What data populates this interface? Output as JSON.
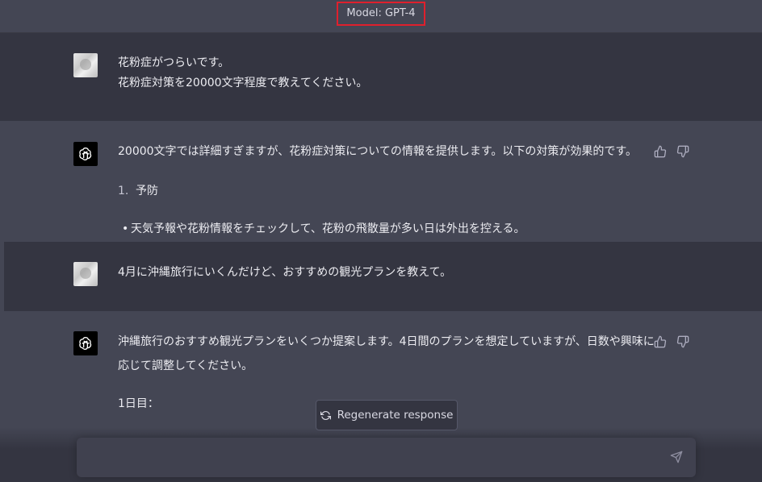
{
  "header": {
    "model_label": "Model: GPT-4"
  },
  "messages": [
    {
      "role": "user",
      "lines": [
        "花粉症がつらいです。",
        "花粉症対策を20000文字程度で教えてください。"
      ]
    },
    {
      "role": "assistant",
      "intro": "20000文字では詳細すぎますが、花粉症対策についての情報を提供します。以下の対策が効果的です。",
      "list_number": "1.",
      "list_item": "予防",
      "bullet_text": "天気予報や花粉情報をチェックして、花粉の飛散量が多い日は外出を控える。"
    },
    {
      "role": "user",
      "lines": [
        "4月に沖縄旅行にいくんだけど、おすすめの観光プランを教えて。"
      ]
    },
    {
      "role": "assistant",
      "line1": "沖縄旅行のおすすめ観光プランをいくつか提案します。4日間のプランを想定していますが、日数や興味に",
      "line2": "応じて調整してください。",
      "day_label": "1日目："
    }
  ],
  "regenerate_label": "Regenerate response",
  "input": {
    "placeholder": ""
  }
}
